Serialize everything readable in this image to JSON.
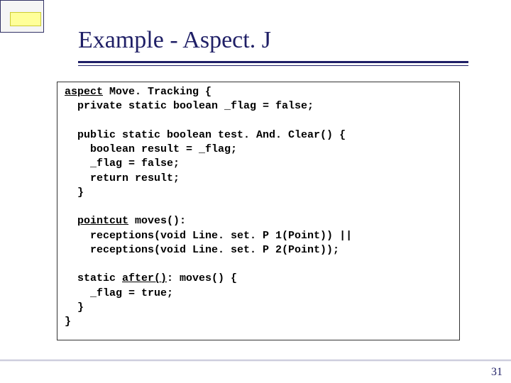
{
  "title": "Example - Aspect. J",
  "page_number": "31",
  "code": {
    "l1a": "aspect",
    "l1b": " Move. Tracking {",
    "l2": "  private static boolean _flag = false;",
    "l3": "  public static boolean test. And. Clear() {",
    "l4": "    boolean result = _flag;",
    "l5": "    _flag = false;",
    "l6": "    return result;",
    "l7": "  }",
    "l8a": "  ",
    "l8b": "pointcut",
    "l8c": " moves():",
    "l9": "    receptions(void Line. set. P 1(Point)) ||",
    "l10": "    receptions(void Line. set. P 2(Point));",
    "l11a": "  static ",
    "l11b": "after()",
    "l11c": ": moves() {",
    "l12": "    _flag = true;",
    "l13": "  }",
    "l14": "}"
  }
}
